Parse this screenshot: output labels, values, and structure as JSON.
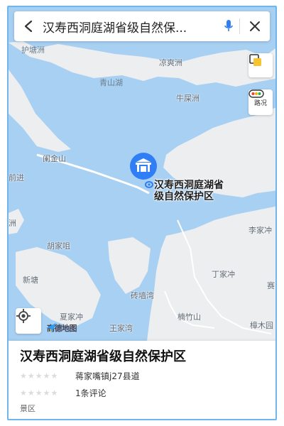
{
  "search": {
    "query": "汉寿西洞庭湖省级自然保..."
  },
  "controls": {
    "traffic_label": "路况"
  },
  "map": {
    "colors": {
      "water": "#a8d0f2",
      "land": "#eceef0",
      "road": "#ffffff"
    },
    "poi_label_line1": "汉寿西洞庭湖省",
    "poi_label_line2": "级自然保护区",
    "logo_text": "高德地图",
    "place_names": {
      "hutangzhou": "护塘洲",
      "liangshuangzhou": "凉爽洲",
      "qingshanhu": "青山湖",
      "niupingzhou": "牛屎洲",
      "lanjinshan": "阑金山",
      "jin": "前进",
      "zhou": "洲",
      "hujiaju": "胡家咀",
      "xintang": "新塘",
      "lijiachong": "李家冲",
      "dingjiachong": "丁家冲",
      "sai": "赛",
      "zhuantangwan": "砖墙湾",
      "xiajiachong": "夏家冲",
      "nanzhushan": "楠竹山",
      "wangjiawan": "王家湾",
      "zhangmuyuan": "樟木园"
    }
  },
  "panel": {
    "title": "汉寿西洞庭湖省级自然保护区",
    "stars": "★★★★★",
    "address": "蒋家嘴镇j27县道",
    "reviews": "1条评论",
    "category": "景区"
  }
}
